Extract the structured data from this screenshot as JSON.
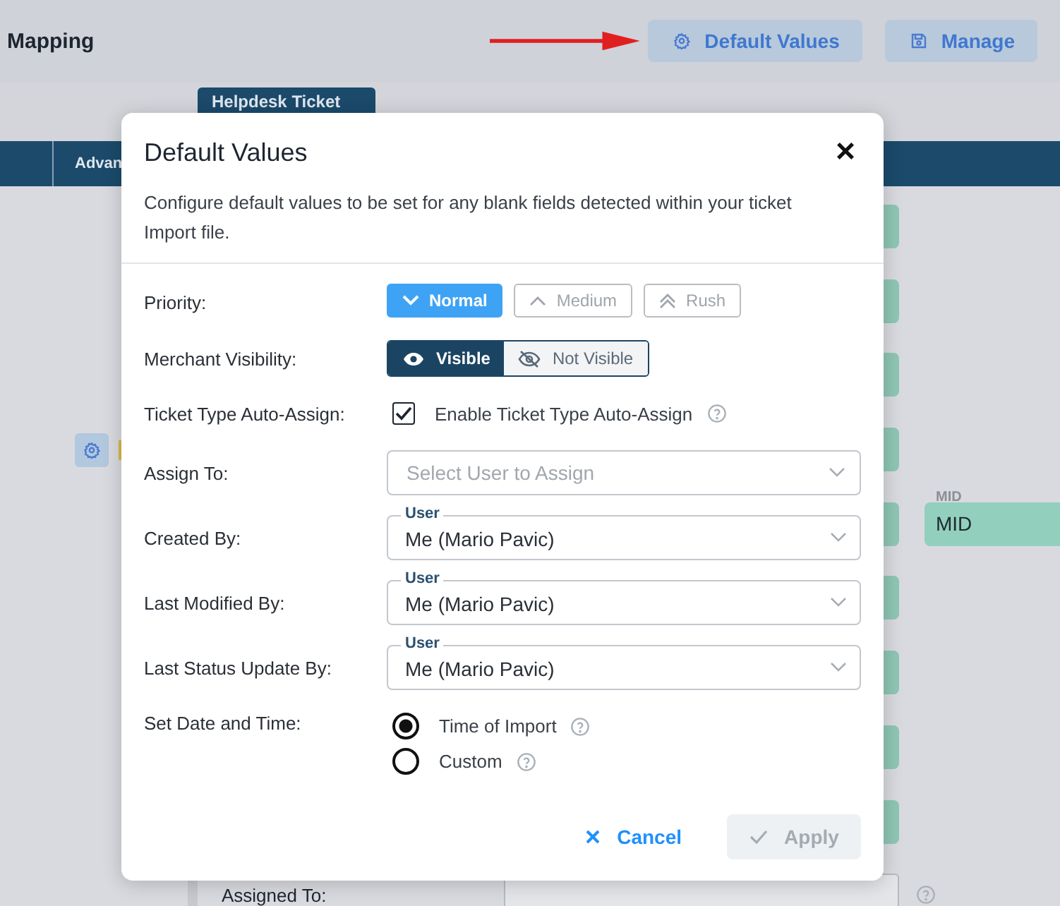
{
  "page": {
    "title": "Mapping",
    "buttons": [
      {
        "label": "Default Values"
      },
      {
        "label": "Manage"
      }
    ],
    "tabs": [
      {
        "label": "Helpdesk Ticket",
        "selected": true
      }
    ],
    "column_header": "Advan",
    "mid_field": {
      "label": "MID",
      "value": "MID"
    },
    "last_row": {
      "label": "Assigned To:"
    }
  },
  "dialog": {
    "title": "Default Values",
    "close": "×",
    "description": "Configure default values to be set for any blank fields detected within your ticket Import file.",
    "rows": [
      {
        "kind": "segmented",
        "label": "Priority:",
        "options": [
          {
            "label": "Normal",
            "selected": true
          },
          {
            "label": "Medium",
            "selected": false
          },
          {
            "label": "Rush",
            "selected": false
          }
        ]
      },
      {
        "kind": "toggle",
        "label": "Merchant Visibility:",
        "options": [
          {
            "label": "Visible",
            "selected": true
          },
          {
            "label": "Not Visible",
            "selected": false
          }
        ]
      },
      {
        "kind": "checkbox",
        "label": "Ticket Type Auto-Assign:",
        "option": {
          "label": "Enable Ticket Type Auto-Assign",
          "checked": true
        }
      },
      {
        "kind": "select",
        "label": "Assign To:",
        "placeholder": "Select User to Assign"
      },
      {
        "kind": "select",
        "label": "Created By:",
        "field_label": "User",
        "value": "Me (Mario Pavic)"
      },
      {
        "kind": "select",
        "label": "Last Modified By:",
        "field_label": "User",
        "value": "Me (Mario Pavic)"
      },
      {
        "kind": "select",
        "label": "Last Status Update By:",
        "field_label": "User",
        "value": "Me (Mario Pavic)"
      },
      {
        "kind": "radio",
        "label": "Set Date and Time:",
        "options": [
          {
            "label": "Time of Import",
            "selected": true
          },
          {
            "label": "Custom",
            "selected": false
          }
        ]
      }
    ],
    "buttons": [
      {
        "kind": "cancel",
        "label": "Cancel",
        "disabled": false
      },
      {
        "kind": "apply",
        "label": "Apply",
        "disabled": true
      }
    ]
  }
}
